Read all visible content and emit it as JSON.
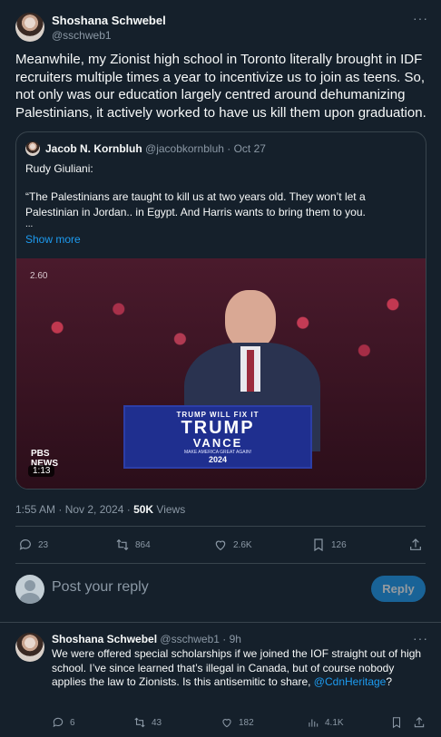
{
  "main_tweet": {
    "author_name": "Shoshana Schwebel",
    "author_handle": "@sschweb1",
    "text": "Meanwhile, my Zionist high school in Toronto literally brought in IDF recruiters multiple times a year to incentivize us to join as teens. So, not only was our education largely centred around dehumanizing Palestinians, it actively worked to have us kill them upon graduation.",
    "timestamp": "1:55 AM · Nov 2, 2024 · ",
    "views_count": "50K",
    "views_label": " Views"
  },
  "quoted_tweet": {
    "author_name": "Jacob N. Kornbluh",
    "author_handle": "@jacobkornbluh",
    "date": " · Oct 27",
    "line1": "Rudy Giuliani:",
    "line2": "“The Palestinians are taught to kill us at two years old. They won’t let a Palestinian in Jordan.. in Egypt. And Harris wants to bring them to you.",
    "line3": "...",
    "show_more": "Show more",
    "video_duration": "1:13",
    "video_counter": "2.60",
    "pbs_logo": "PBS NEWS",
    "sign_line1": "TRUMP WILL FIX IT",
    "sign_line2": "TRUMP",
    "sign_line3": "VANCE",
    "sign_line4": "MAKE AMERICA GREAT AGAIN!",
    "sign_line5": "2024"
  },
  "actions": {
    "replies": "23",
    "reposts": "864",
    "likes": "2.6K",
    "bookmarks": "126"
  },
  "composer": {
    "placeholder": "Post your reply",
    "reply_button": "Reply"
  },
  "reply_tweet": {
    "author_name": "Shoshana Schwebel",
    "author_handle": "@sschweb1",
    "time": " · 9h",
    "text_part1": "We were offered special scholarships if we joined the IOF straight out of high school. I’ve since learned that’s illegal in Canada, but of course nobody applies the law to Zionists. Is this antisemitic to share, ",
    "mention": "@CdnHeritage",
    "text_part2": "?",
    "replies": "6",
    "reposts": "43",
    "likes": "182",
    "views": "4.1K"
  }
}
